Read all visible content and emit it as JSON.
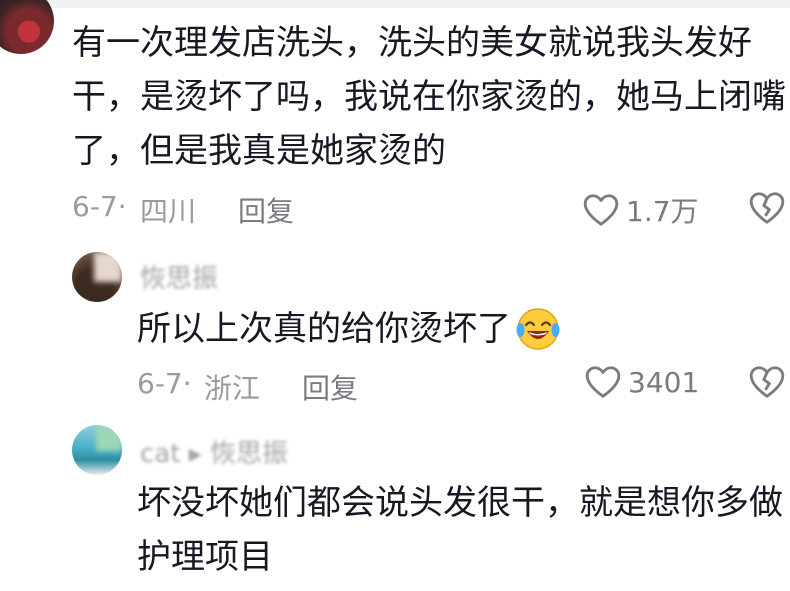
{
  "comments": [
    {
      "author": "",
      "text_lines": [
        "有一次理发店洗头，洗头的美女就说我头发好",
        "干，是烫坏了吗，我说在你家烫的，她马上闭嘴",
        "了，但是我真是她家烫的"
      ],
      "date": "6-7·",
      "location": "四川",
      "reply_label": "回复",
      "like_count": "1.7万"
    },
    {
      "author": "恢思振",
      "text": "所以上次真的给你烫坏了",
      "emoji": "laughing-crying-emoji",
      "date": "6-7·",
      "location": "浙江",
      "reply_label": "回复",
      "like_count": "3401"
    },
    {
      "author": "cat ▸ 恢思振",
      "text_lines": [
        "坏没坏她们都会说头发很干，就是想你多做",
        "护理项目"
      ]
    }
  ],
  "icons": {
    "like": "heart-outline-icon",
    "dislike": "broken-heart-icon"
  },
  "colors": {
    "text": "#161823",
    "meta": "#9a9ba0",
    "icon": "#7a7b80"
  }
}
